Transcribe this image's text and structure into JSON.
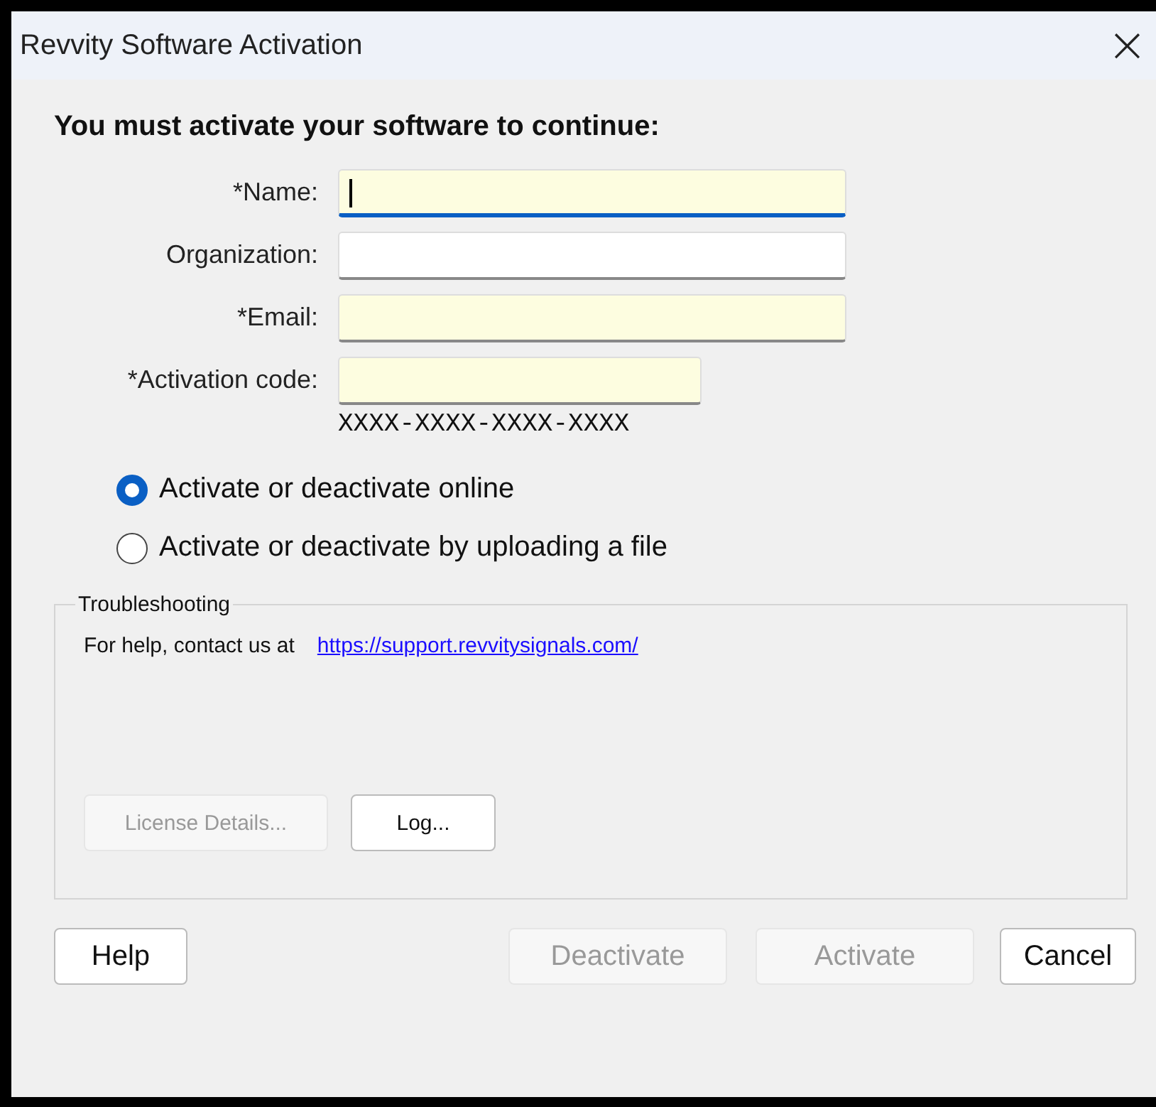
{
  "window": {
    "title": "Revvity Software Activation",
    "close": "×"
  },
  "heading": "You must activate your software to continue:",
  "fields": [
    {
      "label": "*Name:",
      "required": true,
      "focused": true,
      "wide": true
    },
    {
      "label": "Organization:",
      "required": false,
      "focused": false,
      "wide": true
    },
    {
      "label": "*Email:",
      "required": true,
      "focused": false,
      "wide": true
    },
    {
      "label": "*Activation code:",
      "required": true,
      "focused": false,
      "wide": false,
      "hint": "XXXX-XXXX-XXXX-XXXX"
    }
  ],
  "options": [
    {
      "label": "Activate or deactivate online",
      "selected": true
    },
    {
      "label": "Activate or deactivate by uploading a file",
      "selected": false
    }
  ],
  "troubleshooting": {
    "title": "Troubleshooting",
    "text": "For help, contact us at",
    "link": "https://support.revvitysignals.com/",
    "buttons": [
      {
        "label": "License Details...",
        "disabled": true
      },
      {
        "label": "Log...",
        "disabled": false
      }
    ]
  },
  "buttons": [
    {
      "label": "Help",
      "disabled": false
    },
    {
      "label": "Deactivate",
      "disabled": true
    },
    {
      "label": "Activate",
      "disabled": true
    },
    {
      "label": "Cancel",
      "disabled": false
    }
  ]
}
